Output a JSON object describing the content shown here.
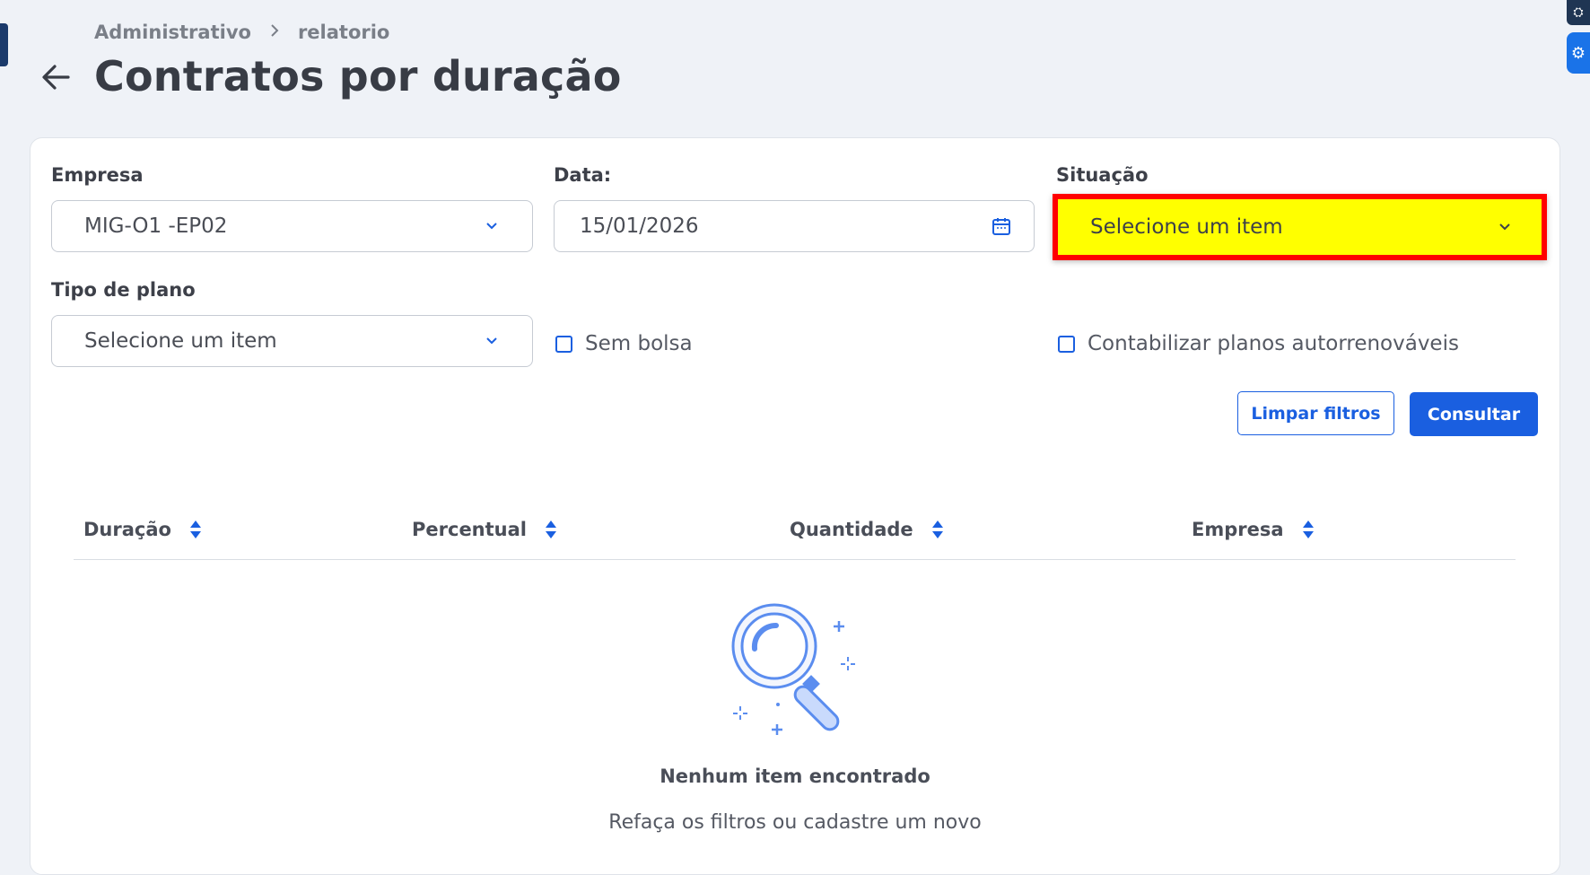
{
  "breadcrumb": {
    "parent": "Administrativo",
    "current": "relatorio"
  },
  "page": {
    "title": "Contratos por duração"
  },
  "filters": {
    "empresa": {
      "label": "Empresa",
      "value": "MIG-O1 -EP02"
    },
    "data": {
      "label": "Data:",
      "value": "15/01/2026"
    },
    "situacao": {
      "label": "Situação",
      "value": "Selecione um item"
    },
    "tipo_plano": {
      "label": "Tipo de plano",
      "value": "Selecione um item"
    },
    "sem_bolsa": {
      "label": "Sem bolsa",
      "checked": false
    },
    "autorrenovaveis": {
      "label": "Contabilizar planos autorrenováveis",
      "checked": false
    }
  },
  "actions": {
    "clear": "Limpar filtros",
    "submit": "Consultar"
  },
  "table": {
    "columns": [
      "Duração",
      "Percentual",
      "Quantidade",
      "Empresa"
    ]
  },
  "empty_state": {
    "title": "Nenhum item encontrado",
    "subtitle": "Refaça os filtros ou cadastre um novo"
  },
  "colors": {
    "primary": "#1a5fe0",
    "highlight_fill": "#ffff00",
    "highlight_border": "#ff0000",
    "background": "#eff2f7"
  },
  "icons": {
    "back": "arrow-left-icon",
    "calendar": "calendar-icon",
    "chevron": "chevron-down-icon",
    "sort": "sort-icon",
    "empty": "magnifier-illustration"
  }
}
